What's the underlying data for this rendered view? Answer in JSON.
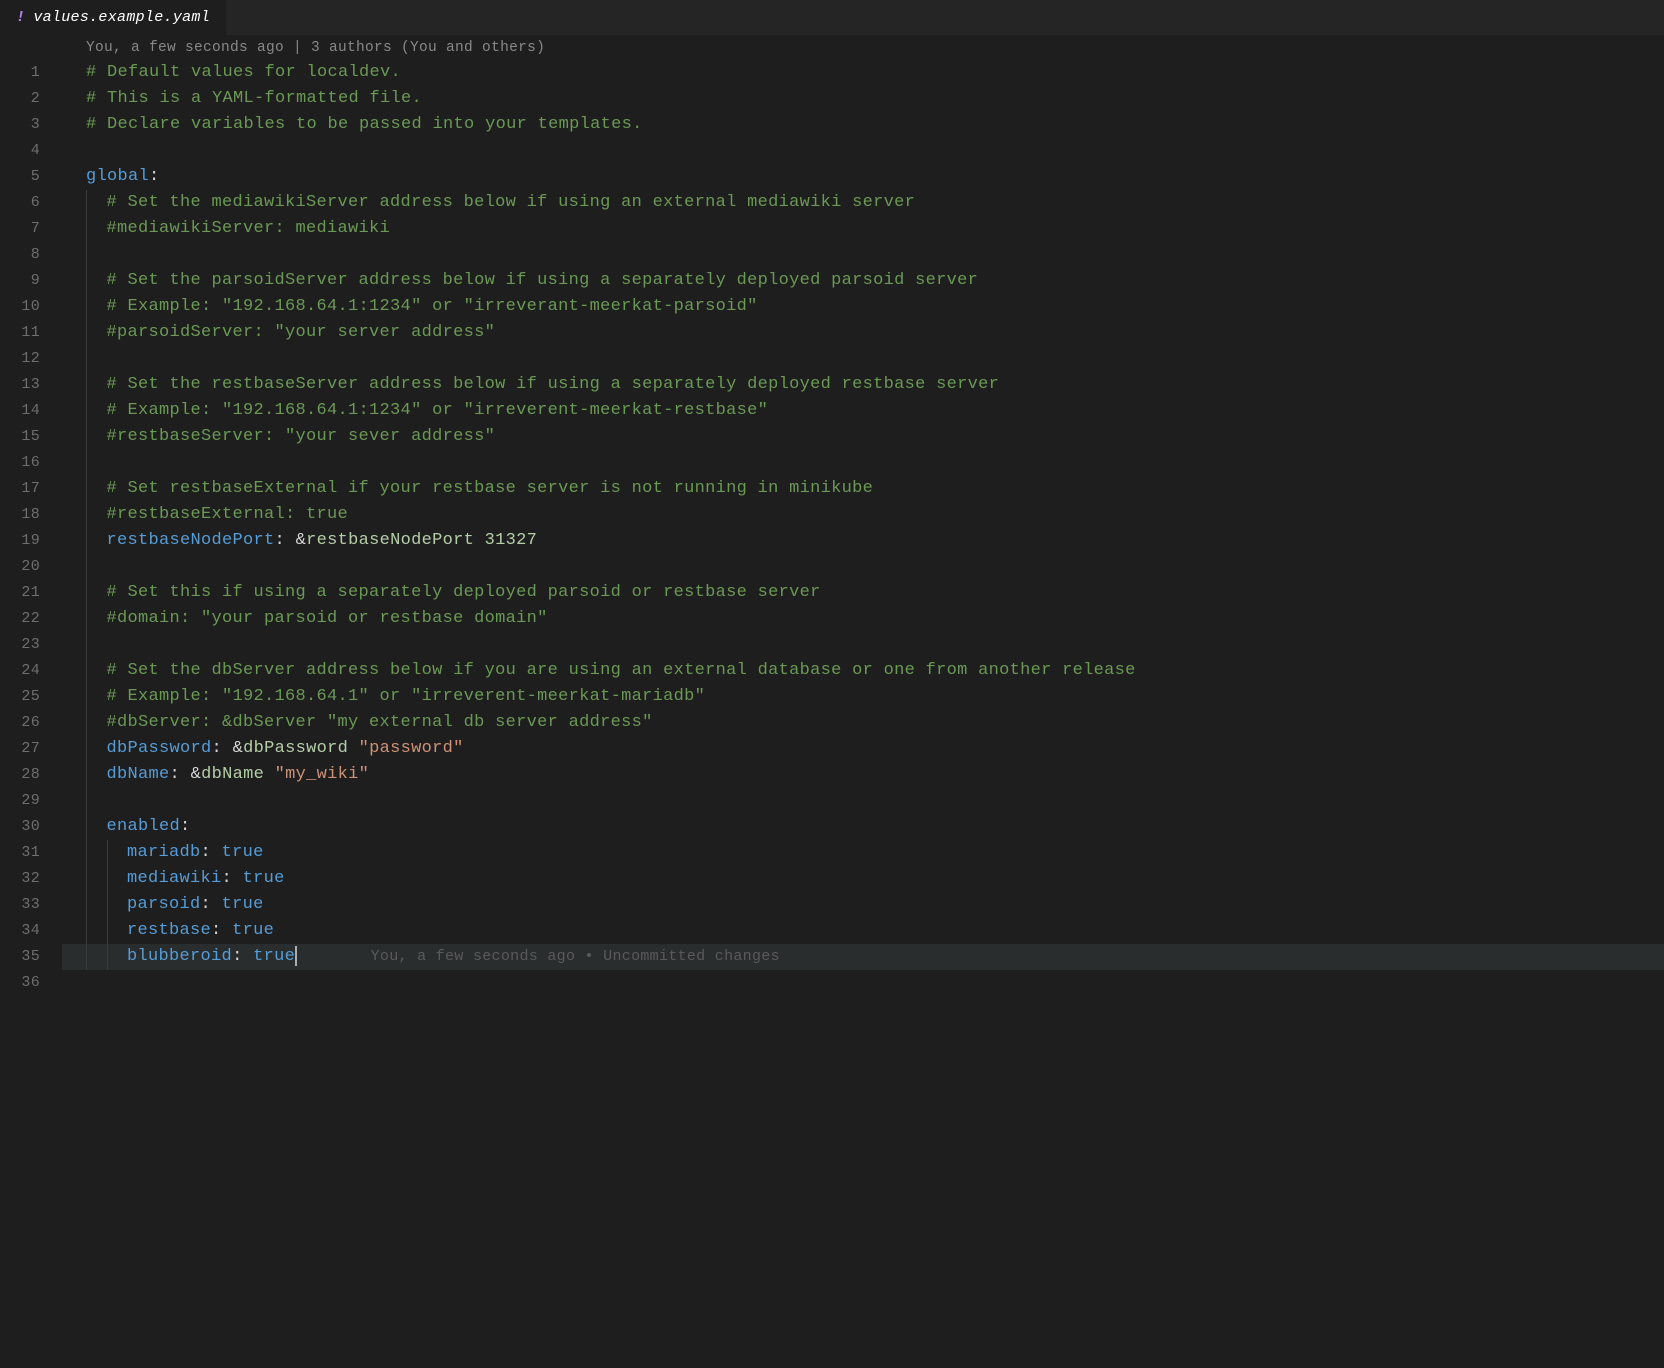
{
  "tab": {
    "icon": "!",
    "filename": "values.example.yaml"
  },
  "codelens": "You, a few seconds ago | 3 authors (You and others)",
  "blame_inline": "You, a few seconds ago • Uncommitted changes",
  "lines": {
    "l1": "# Default values for localdev.",
    "l2": "# This is a YAML-formatted file.",
    "l3": "# Declare variables to be passed into your templates.",
    "l5_key": "global",
    "l6": "# Set the mediawikiServer address below if using an external mediawiki server",
    "l7": "#mediawikiServer: mediawiki",
    "l9": "# Set the parsoidServer address below if using a separately deployed parsoid server",
    "l10": "# Example: \"192.168.64.1:1234\" or \"irreverant-meerkat-parsoid\"",
    "l11": "#parsoidServer: \"your server address\"",
    "l13": "# Set the restbaseServer address below if using a separately deployed restbase server",
    "l14": "# Example: \"192.168.64.1:1234\" or \"irreverent-meerkat-restbase\"",
    "l15": "#restbaseServer: \"your sever address\"",
    "l17": "# Set restbaseExternal if your restbase server is not running in minikube",
    "l18": "#restbaseExternal: true",
    "l19_key": "restbaseNodePort",
    "l19_anchor": "restbaseNodePort",
    "l19_val": "31327",
    "l21": "# Set this if using a separately deployed parsoid or restbase server",
    "l22": "#domain: \"your parsoid or restbase domain\"",
    "l24": "# Set the dbServer address below if you are using an external database or one from another release",
    "l25": "# Example: \"192.168.64.1\" or \"irreverent-meerkat-mariadb\"",
    "l26": "#dbServer: &dbServer \"my external db server address\"",
    "l27_key": "dbPassword",
    "l27_anchor": "dbPassword",
    "l27_val": "\"password\"",
    "l28_key": "dbName",
    "l28_anchor": "dbName",
    "l28_val": "\"my_wiki\"",
    "l30_key": "enabled",
    "l31_key": "mariadb",
    "l31_val": "true",
    "l32_key": "mediawiki",
    "l32_val": "true",
    "l33_key": "parsoid",
    "l33_val": "true",
    "l34_key": "restbase",
    "l34_val": "true",
    "l35_key": "blubberoid",
    "l35_val": "true"
  },
  "line_numbers": [
    "1",
    "2",
    "3",
    "4",
    "5",
    "6",
    "7",
    "8",
    "9",
    "10",
    "11",
    "12",
    "13",
    "14",
    "15",
    "16",
    "17",
    "18",
    "19",
    "20",
    "21",
    "22",
    "23",
    "24",
    "25",
    "26",
    "27",
    "28",
    "29",
    "30",
    "31",
    "32",
    "33",
    "34",
    "35",
    "36"
  ]
}
